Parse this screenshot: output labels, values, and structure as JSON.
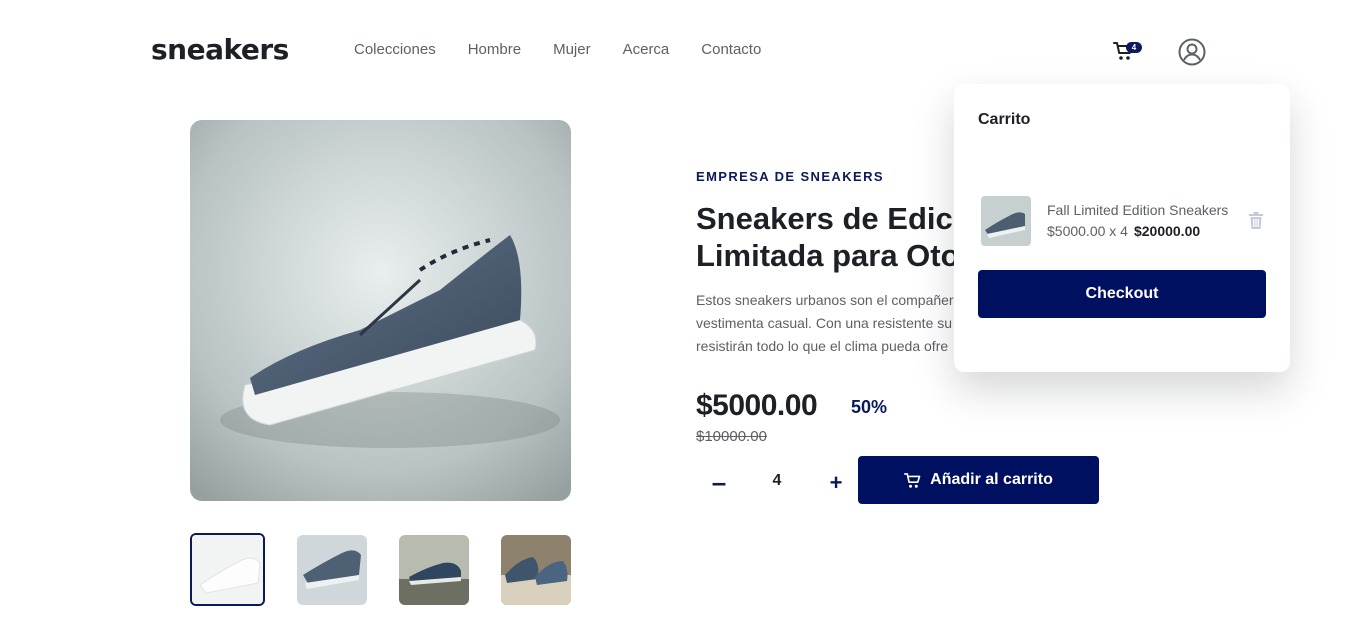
{
  "header": {
    "logo": "sneakers",
    "nav": [
      "Colecciones",
      "Hombre",
      "Mujer",
      "Acerca",
      "Contacto"
    ],
    "cart_count": "4"
  },
  "product": {
    "company": "EMPRESA DE SNEAKERS",
    "title_line1": "Sneakers de Edición",
    "title_line2": "Limitada para Otoño",
    "description_lines": [
      "Estos sneakers urbanos son el compañero",
      "vestimenta casual. Con una resistente su",
      "resistirán todo lo que el clima pueda ofre"
    ],
    "price": "$5000.00",
    "discount": "50%",
    "old_price": "$10000.00",
    "qty_minus": "–",
    "quantity": "4",
    "qty_plus": "+",
    "add_to_cart": "Añadir al carrito"
  },
  "cart": {
    "title": "Carrito",
    "item_name": "Fall Limited Edition Sneakers",
    "item_unit": "$5000.00 x 4",
    "item_total": "$20000.00",
    "checkout": "Checkout"
  },
  "colors": {
    "accent": "#001060",
    "text_dark": "#1d2026",
    "text_muted": "#5c6166"
  }
}
